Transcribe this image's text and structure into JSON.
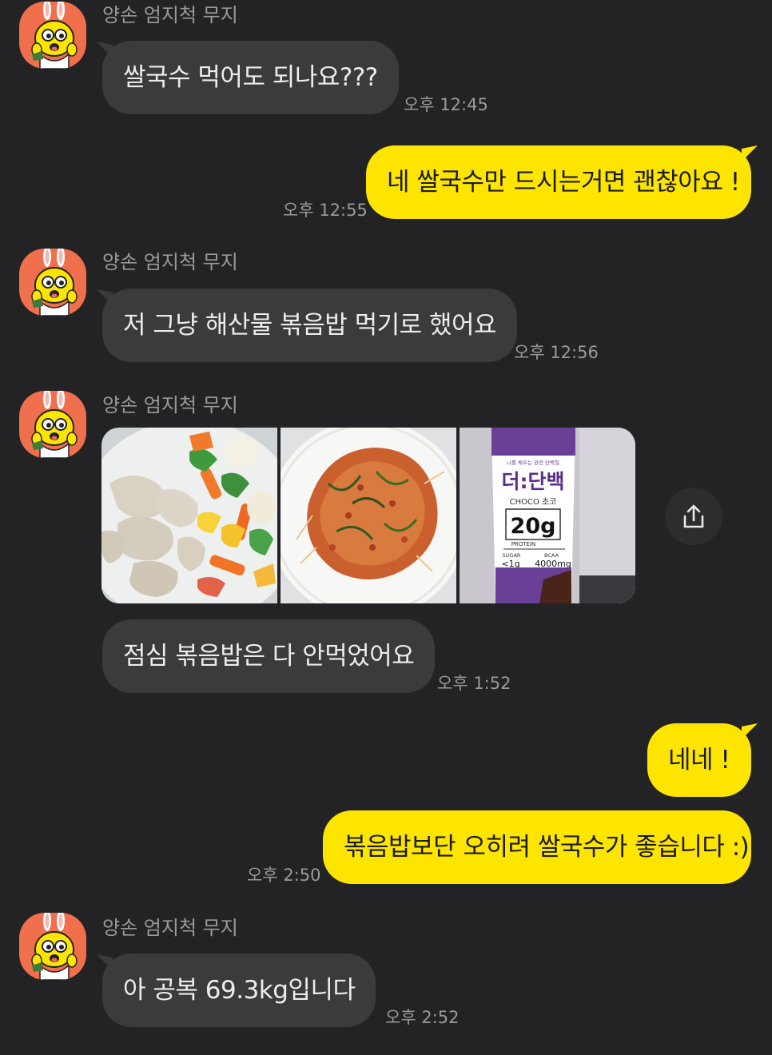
{
  "sender_name": "양손 엄지척 무지",
  "messages": {
    "m1": {
      "text": "쌀국수 먹어도 되나요???",
      "time": "오후 12:45"
    },
    "m2": {
      "text": "네 쌀국수만 드시는거면 괜찮아요 !",
      "time": "오후 12:55"
    },
    "m3": {
      "text": "저 그냥 해산물 볶음밥 먹기로 했어요",
      "time": "오후 12:56"
    },
    "m4": {
      "text": "점심 볶음밥은 다 안먹었어요",
      "time": "오후 1:52"
    },
    "m5": {
      "text": "네네 !"
    },
    "m6": {
      "text": "볶음밥보단 오히려 쌀국수가 좋습니다 :)",
      "time": "오후 2:50"
    },
    "m7": {
      "text": "아 공복 69.3kg입니다",
      "time": "오후 2:52"
    }
  },
  "photos": [
    {
      "name": "chicken-vegetable-photo"
    },
    {
      "name": "fried-rice-photo"
    },
    {
      "name": "protein-drink-photo",
      "label_brand": "더:단백",
      "label_top": "나를 채우는 완전 단백질",
      "label_flavor": "CHOCO 초코",
      "label_protein": "20g",
      "label_protein_word": "PROTEIN",
      "label_sugar_word": "SUGAR",
      "label_sugar": "<1g",
      "label_bcaa_word": "BCAA",
      "label_bcaa": "4000mg"
    }
  ],
  "icons": {
    "avatar": "muzi-rabbit-avatar-icon",
    "share": "share-icon"
  },
  "colors": {
    "background": "#232325",
    "incoming": "#3b3b3d",
    "outgoing": "#fde500",
    "avatar_bg": "#f0704e"
  }
}
